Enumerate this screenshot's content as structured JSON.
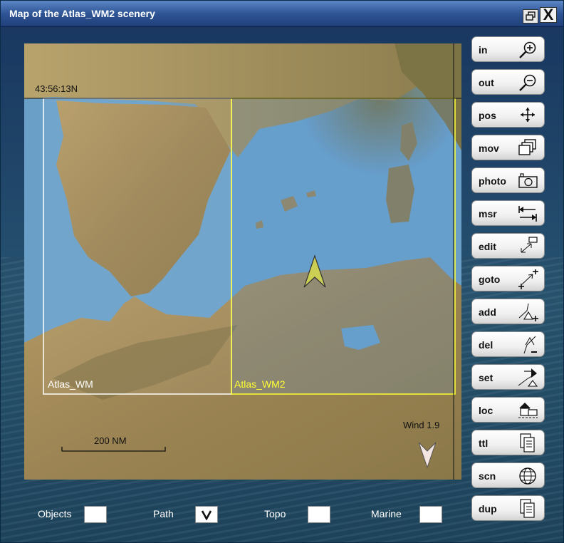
{
  "window": {
    "title": "Map of the Atlas_WM2 scenery",
    "restore_icon": "restore-window-icon",
    "close_label": "X"
  },
  "map": {
    "coordinate": "43:56:13N",
    "regions": [
      {
        "name": "Atlas_WM",
        "color": "#ffffff"
      },
      {
        "name": "Atlas_WM2",
        "color": "#ffff33"
      }
    ],
    "wind": "Wind 1.9",
    "scale": "200 NM",
    "aircraft_icon": "aircraft-marker-icon"
  },
  "toolbar": [
    {
      "id": "in",
      "label": "in",
      "icon": "zoom-in-icon"
    },
    {
      "id": "out",
      "label": "out",
      "icon": "zoom-out-icon"
    },
    {
      "id": "pos",
      "label": "pos",
      "icon": "move-arrows-icon"
    },
    {
      "id": "mov",
      "label": "mov",
      "icon": "stacked-windows-icon"
    },
    {
      "id": "photo",
      "label": "photo",
      "icon": "camera-icon"
    },
    {
      "id": "msr",
      "label": "msr",
      "icon": "measure-arrows-icon"
    },
    {
      "id": "edit",
      "label": "edit",
      "icon": "edit-resize-icon"
    },
    {
      "id": "goto",
      "label": "goto",
      "icon": "goto-arrow-icon"
    },
    {
      "id": "add",
      "label": "add",
      "icon": "add-point-icon"
    },
    {
      "id": "del",
      "label": "del",
      "icon": "delete-point-icon"
    },
    {
      "id": "set",
      "label": "set",
      "icon": "set-point-icon"
    },
    {
      "id": "loc",
      "label": "loc",
      "icon": "location-house-icon"
    },
    {
      "id": "ttl",
      "label": "ttl",
      "icon": "document-stack-icon"
    },
    {
      "id": "scn",
      "label": "scn",
      "icon": "globe-icon"
    },
    {
      "id": "dup",
      "label": "dup",
      "icon": "duplicate-document-icon"
    }
  ],
  "options": [
    {
      "label": "Objects",
      "checked": false,
      "mark": ""
    },
    {
      "label": "Path",
      "checked": true,
      "mark": "V"
    },
    {
      "label": "Topo",
      "checked": false,
      "mark": ""
    },
    {
      "label": "Marine",
      "checked": false,
      "mark": ""
    }
  ],
  "colors": {
    "titlebar": "#2f5595",
    "sea": "#6aa0c8",
    "land": "#a08a5a",
    "wm_region": "#ffffff",
    "wm2_region": "#ffff33"
  }
}
